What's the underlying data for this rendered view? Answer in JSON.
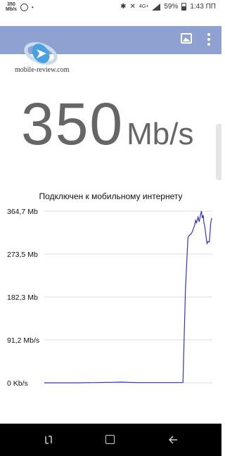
{
  "status_bar": {
    "speed_value": "350",
    "speed_unit": "Mb/s",
    "battery": "59%",
    "time": "1:43 ПП",
    "network": "4G+"
  },
  "logo": {
    "text": "mobile-review.com"
  },
  "speed": {
    "value": "350",
    "unit": "Mb/s"
  },
  "chart_data": {
    "type": "line",
    "title": "Подключен к мобильному интернету",
    "y_ticks": [
      "364,7 Mb",
      "273,5 Mb",
      "182,3 Mb",
      "91,2 Mb/s",
      "0 Kb/s"
    ],
    "ylim": [
      0,
      364.7
    ],
    "xlim": [
      0,
      100
    ],
    "line_color": "#3333cc",
    "grid": true,
    "x": [
      0,
      10,
      20,
      30,
      40,
      46,
      50,
      55,
      60,
      65,
      70,
      75,
      80,
      82.5,
      84,
      85.5,
      86,
      87,
      88,
      89,
      89.5,
      90,
      90.6,
      91.5,
      92.2,
      93,
      93.5,
      94,
      94.6,
      95,
      95.6,
      96,
      96.8,
      97.4,
      98.2,
      99,
      99.6
    ],
    "y": [
      0,
      0,
      0,
      0.5,
      1,
      1.5,
      1,
      0.5,
      0.5,
      0.5,
      0.5,
      0.5,
      0.5,
      0.5,
      200,
      308,
      312,
      315,
      320,
      330,
      335,
      345,
      340,
      352,
      342,
      358,
      364.7,
      350,
      356,
      340,
      330,
      318,
      296,
      300,
      299,
      338,
      350
    ]
  }
}
